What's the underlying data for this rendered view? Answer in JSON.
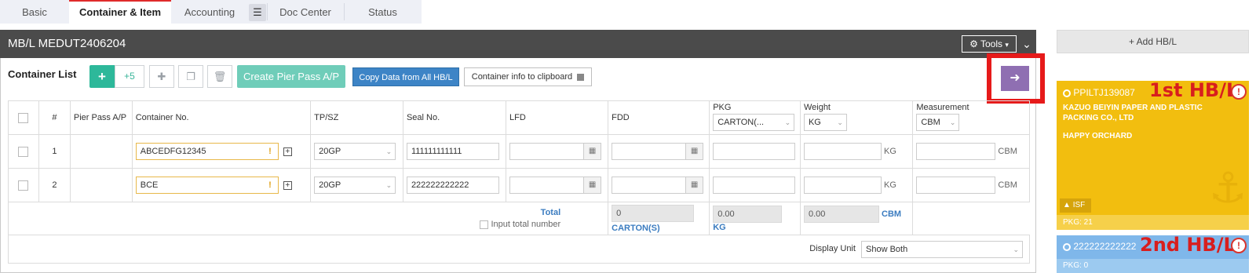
{
  "tabs": [
    {
      "label": "Basic"
    },
    {
      "label": "Container & Item"
    },
    {
      "label": "Accounting"
    },
    {
      "label": "Doc Center"
    },
    {
      "label": "Status"
    }
  ],
  "colors": {
    "accent_tab": "#e02b2b",
    "teal": "#2db89a",
    "blue_button": "#3d84c6",
    "hbl_yellow": "#f2be0f",
    "hbl_blue": "#7fb7ea",
    "highlight_red": "#e61a1a",
    "purple": "#8f6fb2"
  },
  "header": {
    "title": "MB/L MEDUT2406204",
    "tools_label": "Tools",
    "collapse_icon": "chevron-down-icon"
  },
  "container_list": {
    "label": "Container List",
    "plus5_label": "+5",
    "create_pier_pass_label": "Create Pier Pass A/P",
    "copy_data_label": "Copy Data from All HB/L",
    "clipboard_label": "Container info to clipboard"
  },
  "table": {
    "headers": {
      "num": "#",
      "pier_pass": "Pier Pass A/P",
      "container_no": "Container No.",
      "tpsz": "TP/SZ",
      "seal_no": "Seal No.",
      "lfd": "LFD",
      "fdd": "FDD",
      "pkg": "PKG",
      "weight": "Weight",
      "measurement": "Measurement"
    },
    "pkg_unit": "CARTON(...",
    "weight_unit": "KG",
    "measurement_unit": "CBM",
    "rows": [
      {
        "num": "1",
        "container_no": "ABCEDFG12345",
        "tpsz": "20GP",
        "seal_no": "111111111111",
        "weight_unit": "KG",
        "measurement_unit": "CBM"
      },
      {
        "num": "2",
        "container_no": "BCE",
        "tpsz": "20GP",
        "seal_no": "222222222222",
        "weight_unit": "KG",
        "measurement_unit": "CBM"
      }
    ],
    "total": {
      "label": "Total",
      "input_total_label": "Input total number",
      "pkg": "0",
      "pkg_unit": "CARTON(S)",
      "weight": "0.00",
      "weight_unit": "KG",
      "measurement": "0.00",
      "measurement_unit": "CBM"
    },
    "display_unit_label": "Display Unit",
    "display_unit_value": "Show Both"
  },
  "right_panel": {
    "add_hbl_label": "+ Add HB/L",
    "cards": [
      {
        "hbl_no": "PPILTJ139087",
        "shipper": "KAZUO BEIYIN PAPER AND PLASTIC PACKING CO., LTD",
        "consignee": "HAPPY ORCHARD",
        "badge": "ISF",
        "pkg": "PKG: 21",
        "annotation": "1st HB/L"
      },
      {
        "hbl_no": "222222222222",
        "pkg": "PKG: 0",
        "annotation": "2nd HB/L"
      }
    ]
  }
}
